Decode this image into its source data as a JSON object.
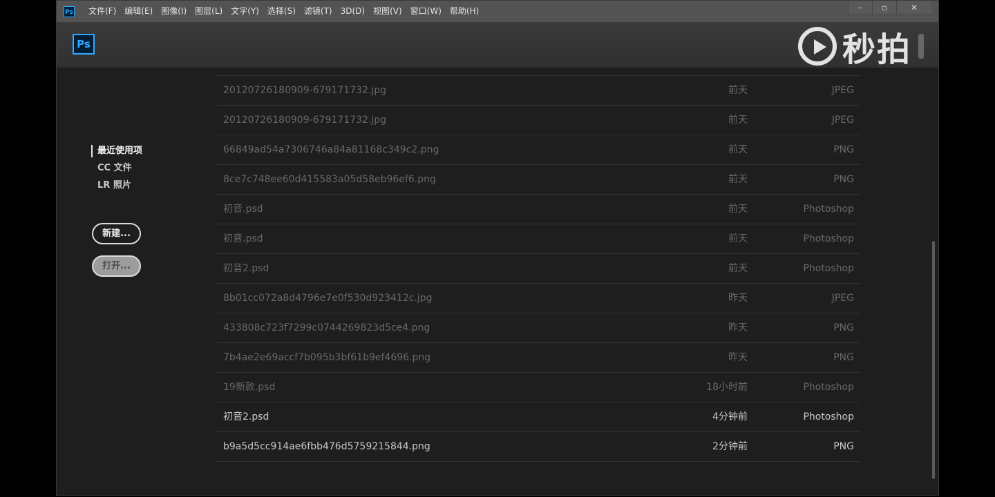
{
  "menu": {
    "items": [
      "文件(F)",
      "编辑(E)",
      "图像(I)",
      "图层(L)",
      "文字(Y)",
      "选择(S)",
      "滤镜(T)",
      "3D(D)",
      "视图(V)",
      "窗口(W)",
      "帮助(H)"
    ],
    "app_icon": "Ps"
  },
  "window_controls": {
    "minimize": "–",
    "maximize": "▫",
    "close": "✕"
  },
  "header": {
    "logo": "Ps"
  },
  "watermark": {
    "text": "秒拍"
  },
  "sidebar": {
    "recent": "最近使用项",
    "cc_files": "CC 文件",
    "lr_photos": "LR 照片",
    "new_button": "新建...",
    "open_button": "打开..."
  },
  "files": [
    {
      "name": "20120726180909-679171732.jpg",
      "date": "前天",
      "type": "JPEG"
    },
    {
      "name": "20120726180909-679171732.jpg",
      "date": "前天",
      "type": "JPEG"
    },
    {
      "name": "66849ad54a7306746a84a81168c349c2.png",
      "date": "前天",
      "type": "PNG"
    },
    {
      "name": "8ce7c748ee60d415583a05d58eb96ef6.png",
      "date": "前天",
      "type": "PNG"
    },
    {
      "name": "初音.psd",
      "date": "前天",
      "type": "Photoshop"
    },
    {
      "name": "初音.psd",
      "date": "前天",
      "type": "Photoshop"
    },
    {
      "name": "初音2.psd",
      "date": "前天",
      "type": "Photoshop"
    },
    {
      "name": "8b01cc072a8d4796e7e0f530d923412c.jpg",
      "date": "昨天",
      "type": "JPEG"
    },
    {
      "name": "433808c723f7299c0744269823d5ce4.png",
      "date": "昨天",
      "type": "PNG"
    },
    {
      "name": "7b4ae2e69accf7b095b3bf61b9ef4696.png",
      "date": "昨天",
      "type": "PNG"
    },
    {
      "name": "19新款.psd",
      "date": "18小时前",
      "type": "Photoshop"
    },
    {
      "name": "初音2.psd",
      "date": "4分钟前",
      "type": "Photoshop"
    },
    {
      "name": "b9a5d5cc914ae6fbb476d5759215844.png",
      "date": "2分钟前",
      "type": "PNG"
    }
  ],
  "colors": {
    "accent": "#31a8ff",
    "background": "#1e1e1e",
    "menubar": "#535353"
  }
}
